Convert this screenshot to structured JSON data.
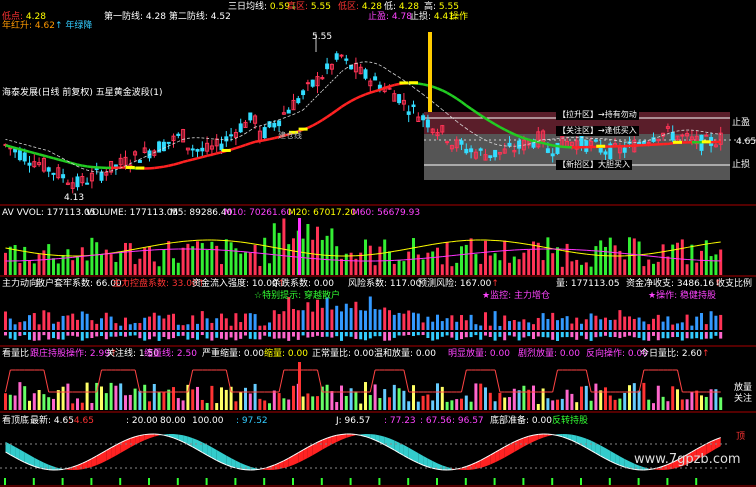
{
  "header": {
    "tl_val1_label": "低点",
    "tl_val1": "4.28",
    "tl_val2_label": "年红升",
    "tl_val2": "4.62",
    "tl_arrow": "↑",
    "tl_val3_label": "年绿降",
    "line1_label": "第一防线",
    "line1": "4.28",
    "line2_label": "第二防线",
    "line2": "4.52",
    "san_label": "三日均线",
    "san": "0.59",
    "san_arrow": "↓",
    "gao_label": "高区",
    "gao": "5.55",
    "di_label": "低区",
    "di": "4.28",
    "di2_label": "低",
    "di2": "4.28",
    "gao2_label": "高",
    "gao2": "5.55",
    "zhiying_label": "止盈",
    "zhiying": "4.78",
    "zhisun_label": "止损",
    "zhisun": "4.41",
    "caozuo_label": "操作",
    "title": "海泰发展(日线 前复权) 五星黄金波段(1)"
  },
  "main_labels": {
    "high_mark": "5.55",
    "low_mark": "4.13",
    "price_right": "4.650",
    "zhiying_right": "止盈",
    "zhisun_right": "止损",
    "zone_a": "【拉升区】→持有勿动",
    "zone_b": "【关注区】→逢低买入",
    "zone_c": "【新招区】大胆买入",
    "green_mark": "建仓线"
  },
  "vol_panel": {
    "label": "AV VVOL: 177113.05",
    "volume": "VOLUME: 177113.05",
    "m5": "M5: 89286.40",
    "m10": "M10: 70261.60",
    "m20": "M20: 67017.20",
    "m60": "M60: 56679.93"
  },
  "capital_panel": {
    "a": "主力动向",
    "b": "散户套牢系数: 66.00",
    "b_arrow": "↑",
    "c": "主力控盘系数: 33.00",
    "c_arrow": "↑",
    "d": "资金流入强度: 10.00",
    "d_arrow": "↑",
    "e": "杀跌系数: 0.00",
    "f": "风险系数: 117.00",
    "g": "预测风险: 167.00",
    "g_arrow": "↑",
    "h": "量: 177113.05",
    "i": "资金净收支: 3486.16",
    "i_arrow": "↑",
    "j": "收支比例",
    "k": "☆特别提示: 穿越散户",
    "l": "★监控: 主力增仓",
    "m": "★操作: 稳健持股"
  },
  "ratio_panel": {
    "a": "看量比",
    "b": "跟庄持股操作: 2.99",
    "b_arrow": "↑",
    "c": "关注线: 1.50",
    "d": "缩量线: 2.50",
    "e": "严重缩量: 0.00",
    "f": "缩量: 0.00",
    "g": "正常量比: 0.00",
    "h": "温和放量: 0.00",
    "i": "明显放量: 0.00",
    "j": "剧烈放量: 0.00",
    "k": "反向操作: 0.00",
    "l": "今日量比: 2.60",
    "l_arrow": "↑",
    "right1": "放量",
    "right2": "关注"
  },
  "kdj_panel": {
    "a": "看顶底",
    "b": "最新: 4.65",
    "c": ": 4.65",
    "d": ": 20.00",
    "e": "80.00",
    "f": "100.00",
    "g": ": 97.52",
    "h": "J: 96.57",
    "i": ": 77.23",
    "j": ": 67.56",
    "k": ": 96.57",
    "l": "底部准备: 0.00",
    "m": "反转持股",
    "right": "顶",
    "arrows": "↑"
  },
  "watermark": "www.7gpzb.com",
  "colors": {
    "up": "#ff3355",
    "down": "#33ddff",
    "ma_red": "#ff2222",
    "ma_green": "#22cc22",
    "yellow": "#ffff00",
    "magenta": "#ff33ff",
    "panel_line": "#aa0000"
  },
  "chart_data": {
    "type": "candlestick",
    "title": "海泰发展(日线 前复权) 五星黄金波段(1)",
    "high": 5.55,
    "low": 4.13,
    "latest_close": 4.65,
    "ylim": [
      4.0,
      5.7
    ],
    "series": [
      {
        "name": "MA",
        "color": "#ff2222"
      },
      {
        "name": "MA",
        "color": "#22cc22"
      }
    ],
    "volume": {
      "latest": 177113.05,
      "M5": 89286.4,
      "M10": 70261.6,
      "M20": 67017.2,
      "M60": 56679.93
    }
  }
}
